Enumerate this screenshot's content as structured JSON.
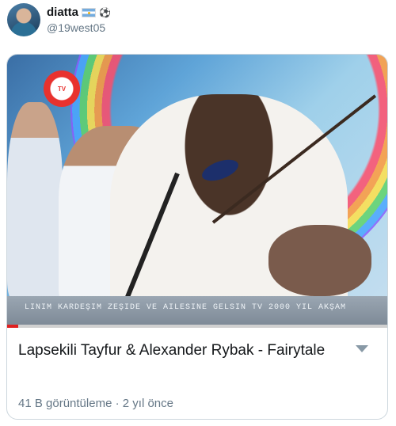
{
  "tweet": {
    "display_name": "diatta",
    "name_emoji": "⚽",
    "handle": "@19west05"
  },
  "video": {
    "title": "Lapsekili Tayfur & Alexander Rybak - Fairytale",
    "views": "41 B görüntüleme",
    "separator": "·",
    "age": "2 yıl önce",
    "ticker_text": "LINIM KARDEŞIM ZEŞIDE VE AILESINE GELSIN     TV 2000 YIL AKŞAM",
    "channel_logo_text": "TV",
    "progress_fraction": 0.03
  },
  "colors": {
    "name": "#14171a",
    "secondary": "#657786",
    "card_border": "#ccd6dd",
    "progress": "#e02020"
  }
}
